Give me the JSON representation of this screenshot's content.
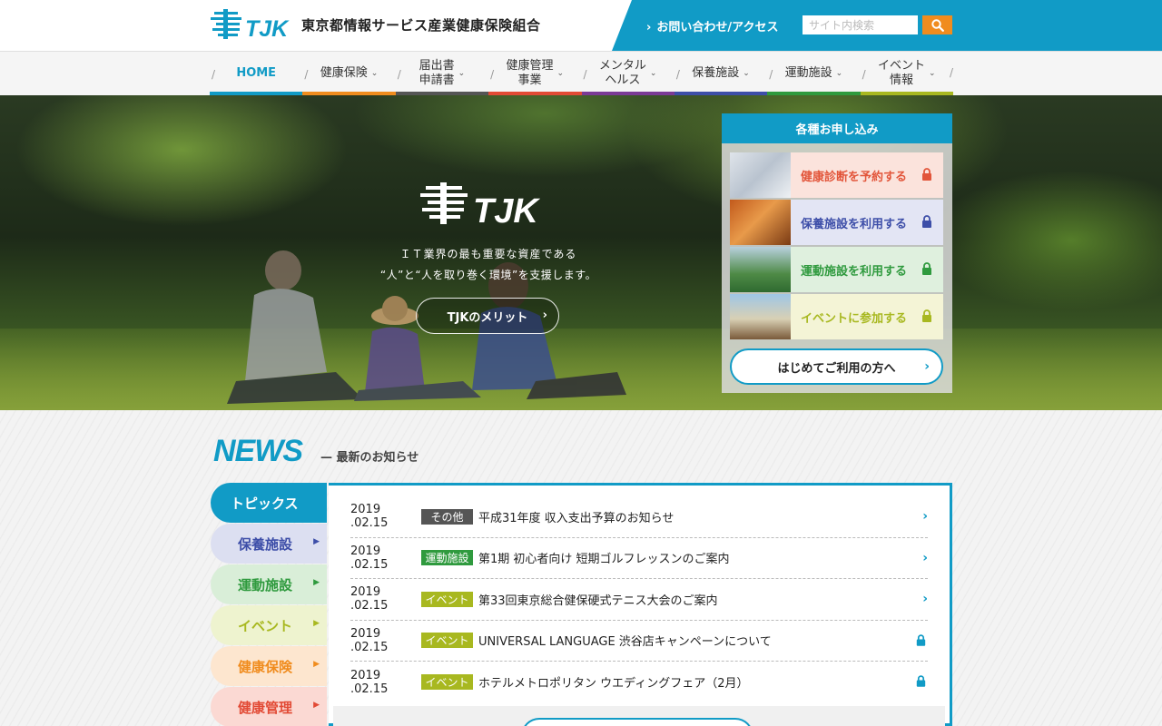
{
  "header": {
    "org_name": "東京都情報サービス産業健康保険組合",
    "logo_text": "TJK",
    "contact_label": "お問い合わせ/アクセス",
    "search_placeholder": "サイト内検索",
    "search_icon": "magnifier-icon",
    "accent_color": "#119bc6"
  },
  "nav": {
    "items": [
      {
        "label": "HOME",
        "active": true,
        "color": "#119bc6"
      },
      {
        "label": "健康保険",
        "color": "#f08c1e"
      },
      {
        "label": "届出書\n申請書",
        "color": "#555555"
      },
      {
        "label": "健康管理\n事業",
        "color": "#e24a35"
      },
      {
        "label": "メンタル\nヘルス",
        "color": "#7b3a96"
      },
      {
        "label": "保養施設",
        "color": "#3d4ea8"
      },
      {
        "label": "運動施設",
        "color": "#2f9a3e"
      },
      {
        "label": "イベント\n情報",
        "color": "#a8b820"
      }
    ]
  },
  "hero": {
    "logo_text": "TJK",
    "tagline_1": "ＩＴ業界の最も重要な資産である",
    "tagline_2": "“人”と“人を取り巻く環境”を支援します。",
    "merit_button": "TJKのメリット"
  },
  "apply": {
    "title": "各種お申し込み",
    "items": [
      {
        "label": "健康診断を予約する",
        "color": "#e2553a",
        "bg": "#fbe3dc"
      },
      {
        "label": "保養施設を利用する",
        "color": "#3d4ea8",
        "bg": "#e3e5f4"
      },
      {
        "label": "運動施設を利用する",
        "color": "#2f9a3e",
        "bg": "#dff0de"
      },
      {
        "label": "イベントに参加する",
        "color": "#a8b820",
        "bg": "#f4f4d6"
      }
    ],
    "first_time_button": "はじめてご利用の方へ"
  },
  "news": {
    "title": "NEWS",
    "subtitle": "— 最新のお知らせ",
    "tabs": [
      {
        "label": "トピックス",
        "active": true,
        "bg": "#119bc6",
        "color": "#ffffff"
      },
      {
        "label": "保養施設",
        "bg": "#dcdff1",
        "color": "#3d4ea8"
      },
      {
        "label": "運動施設",
        "bg": "#d9eed8",
        "color": "#2f9a3e"
      },
      {
        "label": "イベント",
        "bg": "#eef3cf",
        "color": "#a8b820"
      },
      {
        "label": "健康保険",
        "bg": "#fde6cf",
        "color": "#f08c1e"
      },
      {
        "label": "健康管理",
        "bg": "#fbd9d3",
        "color": "#e24a35"
      }
    ],
    "items": [
      {
        "date": "2019 .02.15",
        "badge": "その他",
        "badge_color": "#555555",
        "text": "平成31年度 収入支出予算のお知らせ",
        "locked": false
      },
      {
        "date": "2019 .02.15",
        "badge": "運動施設",
        "badge_color": "#2f9a3e",
        "text": "第1期 初心者向け 短期ゴルフレッスンのご案内",
        "locked": false
      },
      {
        "date": "2019 .02.15",
        "badge": "イベント",
        "badge_color": "#a8b820",
        "text": "第33回東京総合健保硬式テニス大会のご案内",
        "locked": false
      },
      {
        "date": "2019 .02.15",
        "badge": "イベント",
        "badge_color": "#a8b820",
        "text": "UNIVERSAL LANGUAGE 渋谷店キャンペーンについて",
        "locked": true
      },
      {
        "date": "2019 .02.15",
        "badge": "イベント",
        "badge_color": "#a8b820",
        "text": "ホテルメトロポリタン ウエディングフェア（2月）",
        "locked": true
      }
    ]
  }
}
